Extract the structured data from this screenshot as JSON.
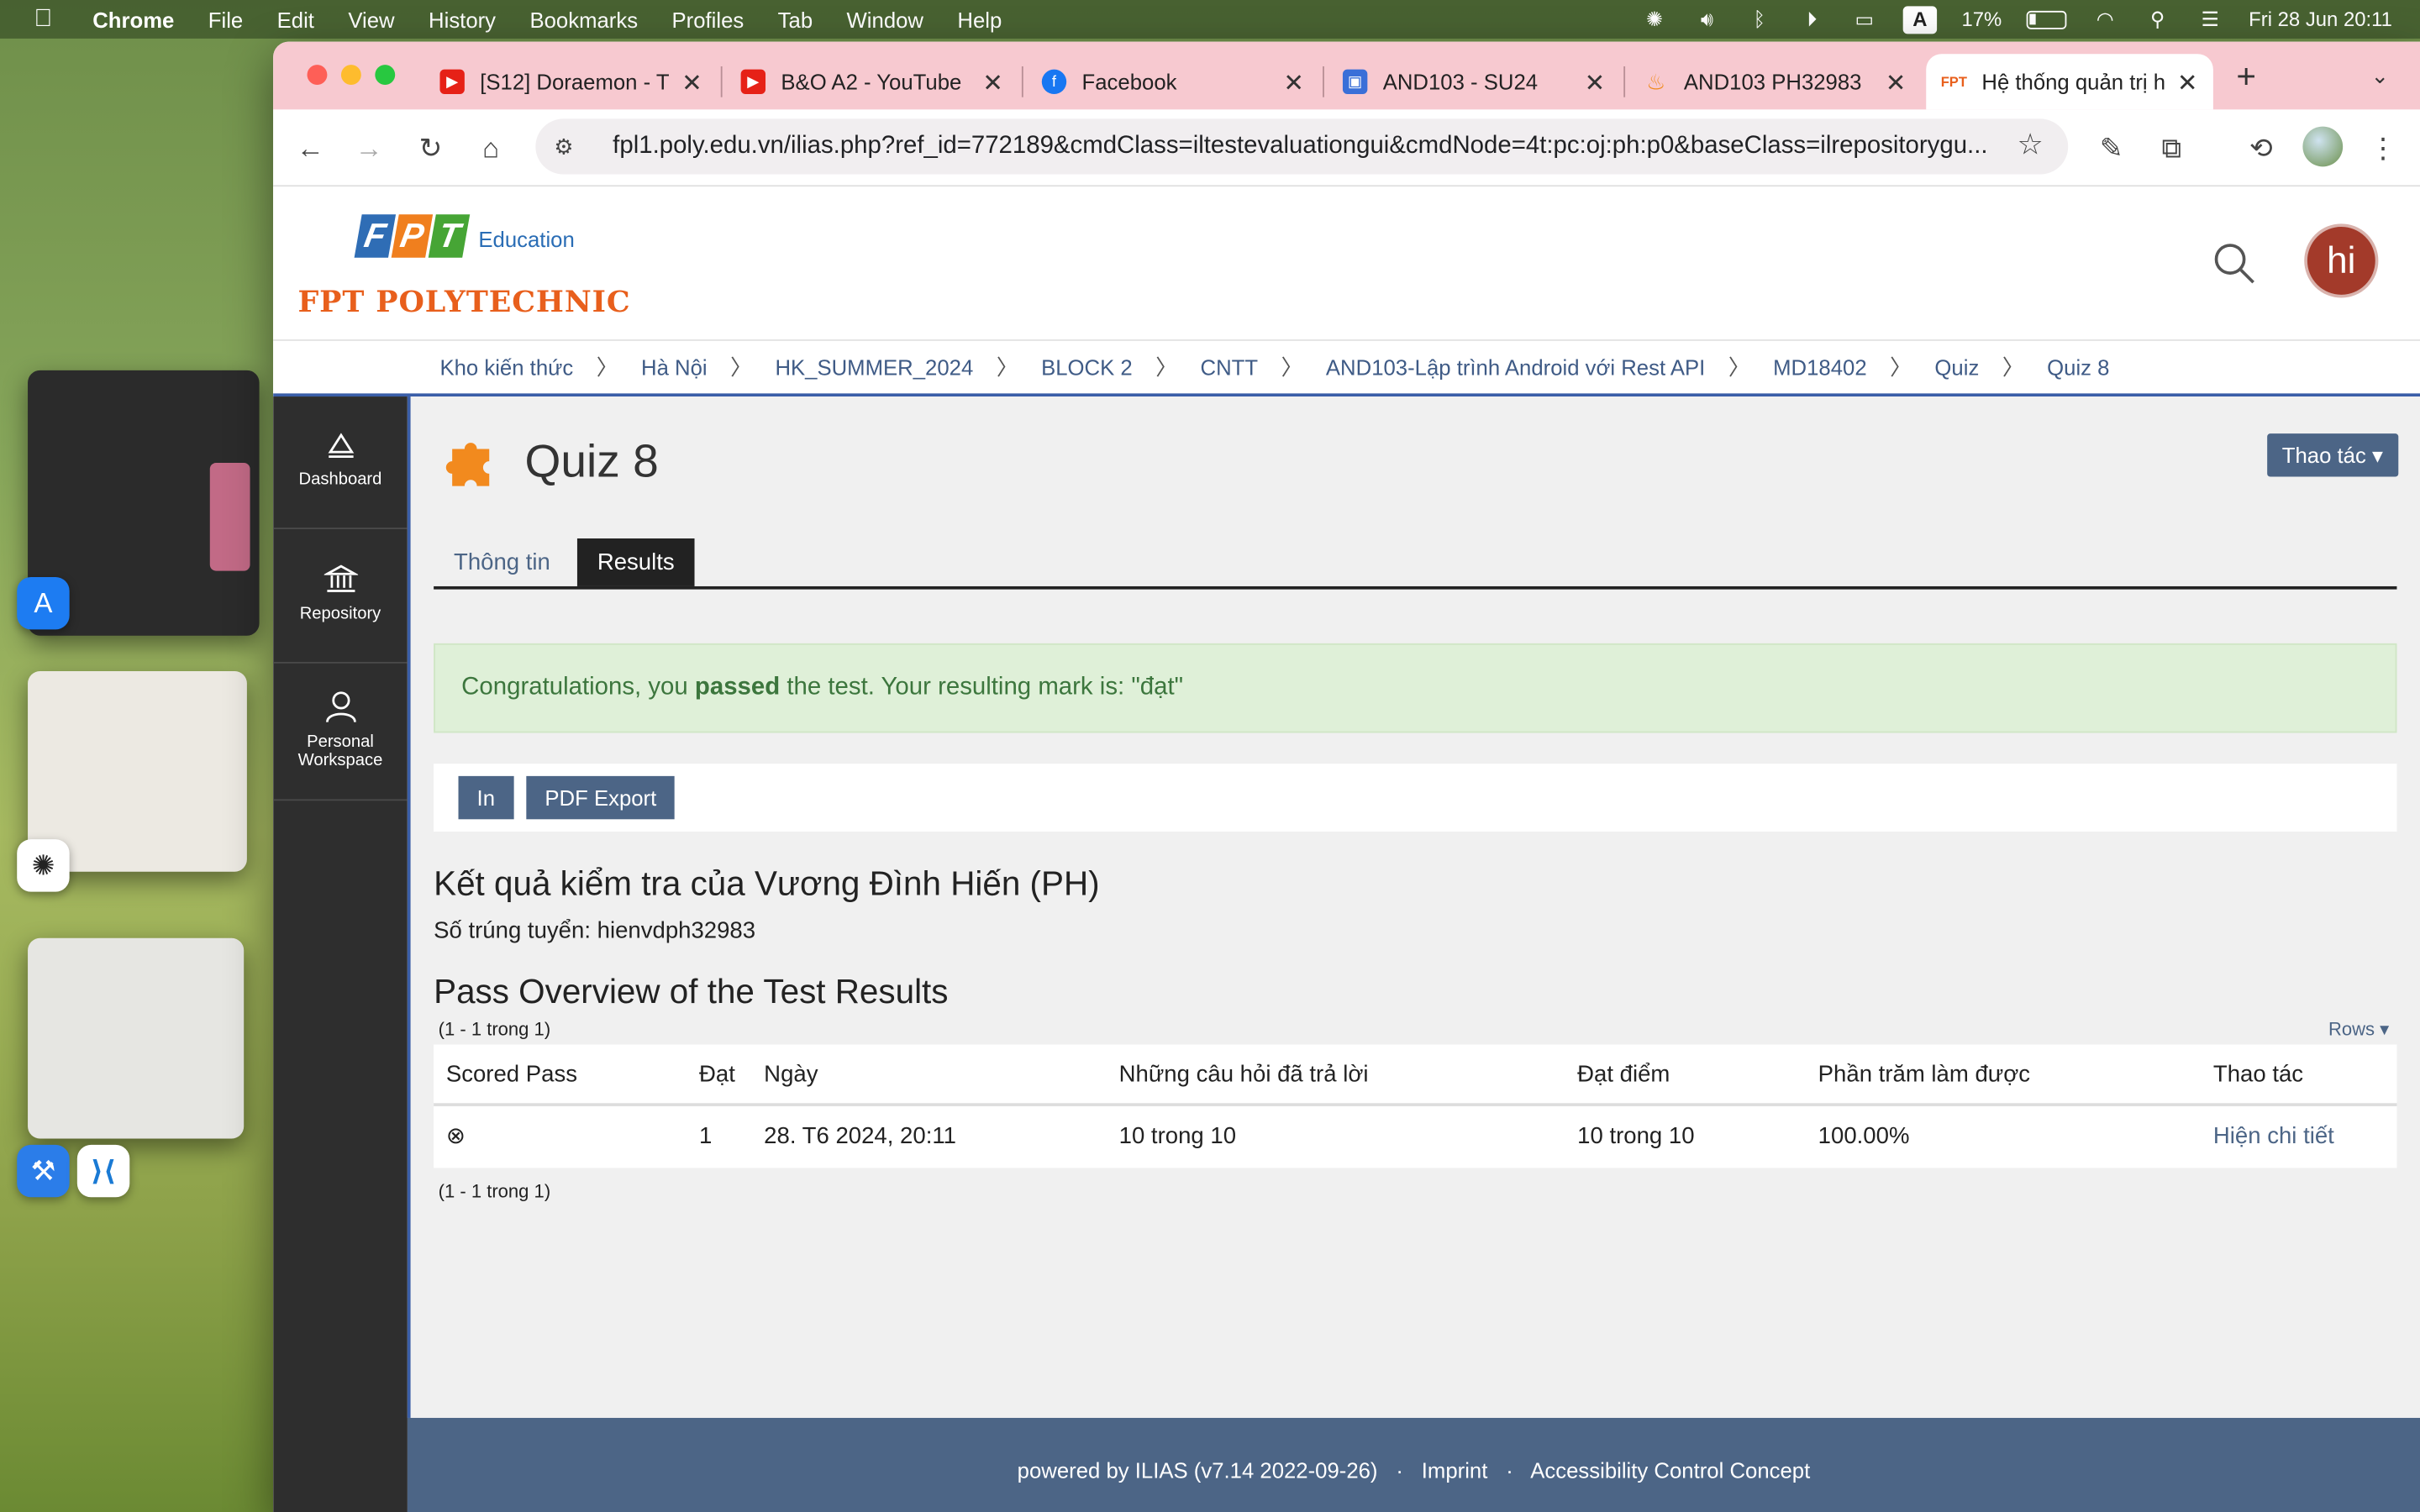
{
  "menubar": {
    "app": "Chrome",
    "menus": [
      "File",
      "Edit",
      "View",
      "History",
      "Bookmarks",
      "Profiles",
      "Tab",
      "Window",
      "Help"
    ],
    "input_indicator": "A",
    "battery": "17%",
    "clock": "Fri 28 Jun  20:11"
  },
  "tabs": [
    {
      "title": "[S12] Doraemon - T",
      "favicon": "youtube-icon",
      "color": "#e62117"
    },
    {
      "title": "B&O A2 - YouTube",
      "favicon": "youtube-icon",
      "color": "#e62117"
    },
    {
      "title": "Facebook",
      "favicon": "facebook-icon",
      "color": "#1877f2"
    },
    {
      "title": "AND103 - SU24",
      "favicon": "classroom-icon",
      "color": "#3a6fd8"
    },
    {
      "title": "AND103 PH32983",
      "favicon": "firebase-icon",
      "color": "#f08a1c"
    },
    {
      "title": "Hệ thống quản trị h",
      "favicon": "fpt-icon",
      "color": "#e85f1c"
    }
  ],
  "address_bar": {
    "url": "fpl1.poly.edu.vn/ilias.php?ref_id=772189&cmdClass=iltestevaluationgui&cmdNode=4t:pc:oj:ph:p0&baseClass=ilrepositorygu..."
  },
  "header": {
    "logo_edu": "Education",
    "logo_name": "FPT POLYTECHNIC",
    "user_initials": "hi"
  },
  "breadcrumbs": [
    "Kho kiến thức",
    "Hà Nội",
    "HK_SUMMER_2024",
    "BLOCK 2",
    "CNTT",
    "AND103-Lập trình Android với Rest API",
    "MD18402",
    "Quiz",
    "Quiz 8"
  ],
  "sidebar": [
    {
      "label": "Dashboard",
      "icon": "dashboard-icon"
    },
    {
      "label": "Repository",
      "icon": "repository-icon"
    },
    {
      "label_line1": "Personal",
      "label_line2": "Workspace",
      "icon": "person-icon"
    }
  ],
  "page": {
    "title": "Quiz 8",
    "actions_label": "Thao tác ▾",
    "tabs": [
      "Thông tin",
      "Results"
    ],
    "active_tab": "Results",
    "alert": {
      "before": "Congratulations, you ",
      "bold": "passed",
      "after": " the test. Your resulting mark is: \"đạt\""
    },
    "buttons": {
      "print": "In",
      "pdf": "PDF Export"
    },
    "result_title": "Kết quả kiểm tra của Vương Đình Hiến (PH)",
    "registration": "Số trúng tuyển: hienvdph32983",
    "overview_title": "Pass Overview of the Test Results",
    "count_text": "(1 - 1 trong 1)",
    "rows_label": "Rows ▾",
    "table": {
      "headers": [
        "Scored Pass",
        "Đạt",
        "Ngày",
        "Những câu hỏi đã trả lời",
        "Đạt điểm",
        "Phần trăm làm được",
        "Thao tác"
      ],
      "rows": [
        [
          "⊗",
          "1",
          "28. T6 2024, 20:11",
          "10 trong 10",
          "10 trong 10",
          "100.00%",
          "Hiện chi tiết"
        ]
      ]
    }
  },
  "footer": {
    "powered": "powered by ILIAS (v7.14 2022-09-26)",
    "imprint": "Imprint",
    "accessibility": "Accessibility Control Concept"
  }
}
